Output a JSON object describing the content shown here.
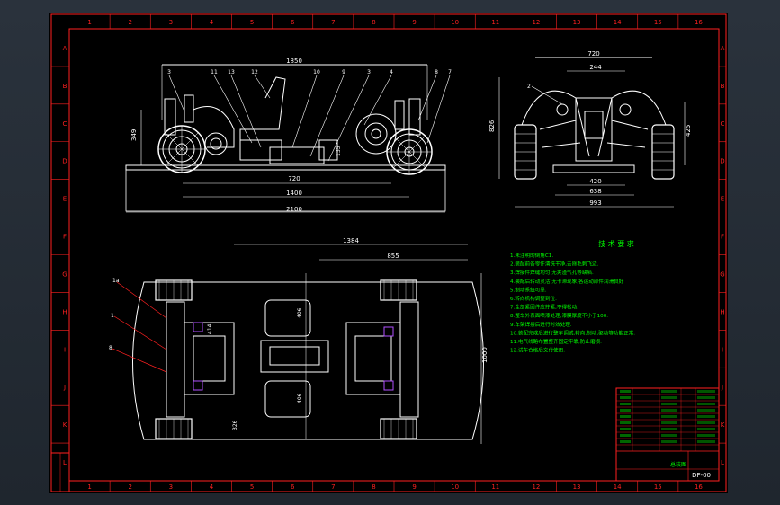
{
  "border": {
    "columns": [
      "1",
      "2",
      "3",
      "4",
      "5",
      "6",
      "7",
      "8",
      "9",
      "10",
      "11",
      "12",
      "13",
      "14",
      "15",
      "16"
    ],
    "rows": [
      "A",
      "B",
      "C",
      "D",
      "E",
      "F",
      "G",
      "H",
      "I",
      "J",
      "K",
      "L"
    ]
  },
  "side_view": {
    "dims": {
      "overall": "1850",
      "height": "349",
      "seat_h": "135",
      "mid": "720",
      "wheelbase": "1400",
      "total": "2100"
    },
    "callouts": [
      "3",
      "11",
      "13",
      "12",
      "10",
      "9",
      "3",
      "4",
      "8",
      "7"
    ]
  },
  "front_view": {
    "dims": {
      "overall": "720",
      "inner": "244",
      "height": "826",
      "right_h": "425",
      "track": "420",
      "width1": "638",
      "width2": "993"
    },
    "callouts": [
      "2"
    ]
  },
  "plan_view": {
    "dims": {
      "length": "1384",
      "front": "855",
      "half1": "406",
      "half2": "406",
      "side": "1000",
      "left_small": "326",
      "mid_small": "414"
    },
    "callouts": [
      "1a",
      "1",
      "8"
    ]
  },
  "notes": {
    "title": "技 术 要 求",
    "lines": [
      "1.未注明的倒角C1.",
      "2.装配前各零件清洗干净,去除毛刺飞边.",
      "3.焊接件焊缝均匀,无夹渣气孔等缺陷.",
      "4.装配后转动灵活,无卡滞现象,各运动部件润滑良好",
      "5.制动系统可靠.",
      "6.转向机构调整到位.",
      "7.全部紧固件应拧紧,不得松动.",
      "8.整车外表面喷漆处理,漆膜厚度不小于100.",
      "9.车架焊接后进行时效处理.",
      "10.装配完成后进行整车调试,转向,制动,驱动等功能正常.",
      "11.电气线路布置整齐固定牢靠,防止磨损.",
      "12.试车合格后交付使用."
    ]
  },
  "title_block": {
    "drawing_no": "DF-00",
    "name": "总装图"
  },
  "colors": {
    "sheet": "#000000",
    "frame": "#ff2020",
    "lines": "#ffffff",
    "dims": "#00ff00",
    "purple": "#b050ff"
  }
}
